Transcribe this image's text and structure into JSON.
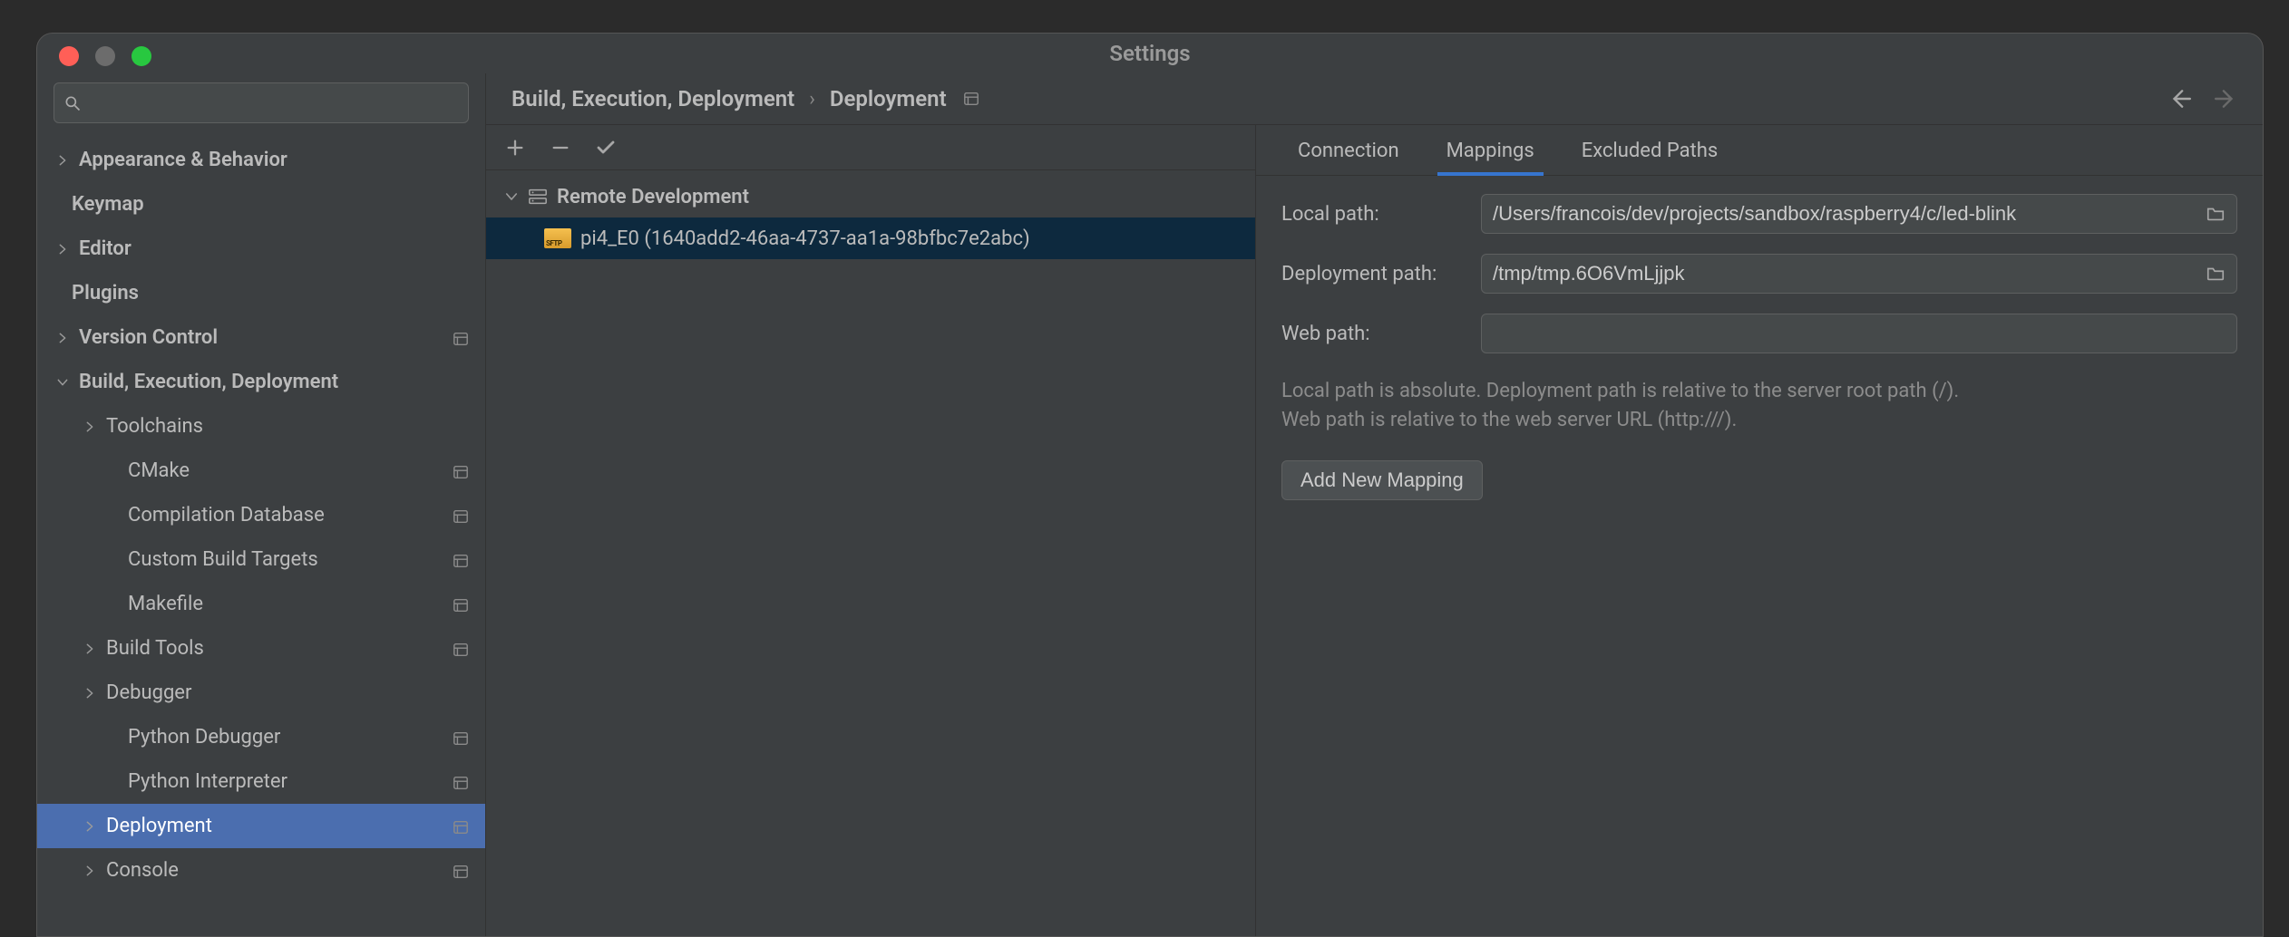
{
  "window": {
    "title": "Settings"
  },
  "search": {
    "value": "",
    "placeholder": ""
  },
  "sidebar": {
    "items": [
      {
        "label": "Appearance & Behavior",
        "chev": "right",
        "bold": true,
        "proj": false,
        "indent": "0c"
      },
      {
        "label": "Keymap",
        "chev": "",
        "bold": true,
        "proj": false,
        "indent": "0"
      },
      {
        "label": "Editor",
        "chev": "right",
        "bold": true,
        "proj": false,
        "indent": "0c"
      },
      {
        "label": "Plugins",
        "chev": "",
        "bold": true,
        "proj": false,
        "indent": "0"
      },
      {
        "label": "Version Control",
        "chev": "right",
        "bold": true,
        "proj": true,
        "indent": "0c"
      },
      {
        "label": "Build, Execution, Deployment",
        "chev": "down",
        "bold": true,
        "proj": false,
        "indent": "0c"
      },
      {
        "label": "Toolchains",
        "chev": "right",
        "bold": false,
        "proj": false,
        "indent": "1c"
      },
      {
        "label": "CMake",
        "chev": "",
        "bold": false,
        "proj": true,
        "indent": "2"
      },
      {
        "label": "Compilation Database",
        "chev": "",
        "bold": false,
        "proj": true,
        "indent": "2"
      },
      {
        "label": "Custom Build Targets",
        "chev": "",
        "bold": false,
        "proj": true,
        "indent": "2"
      },
      {
        "label": "Makefile",
        "chev": "",
        "bold": false,
        "proj": true,
        "indent": "2"
      },
      {
        "label": "Build Tools",
        "chev": "right",
        "bold": false,
        "proj": true,
        "indent": "1c"
      },
      {
        "label": "Debugger",
        "chev": "right",
        "bold": false,
        "proj": false,
        "indent": "1c"
      },
      {
        "label": "Python Debugger",
        "chev": "",
        "bold": false,
        "proj": true,
        "indent": "2"
      },
      {
        "label": "Python Interpreter",
        "chev": "",
        "bold": false,
        "proj": true,
        "indent": "2"
      },
      {
        "label": "Deployment",
        "chev": "right",
        "bold": false,
        "proj": true,
        "indent": "1c",
        "selected": true
      },
      {
        "label": "Console",
        "chev": "right",
        "bold": false,
        "proj": true,
        "indent": "1c"
      }
    ]
  },
  "breadcrumb": {
    "a": "Build, Execution, Deployment",
    "b": "Deployment"
  },
  "servers": {
    "group": "Remote Development",
    "items": [
      {
        "label": "pi4_E0 (1640add2-46aa-4737-aa1a-98bfbc7e2abc)",
        "selected": true
      }
    ]
  },
  "tabs": [
    {
      "label": "Connection"
    },
    {
      "label": "Mappings",
      "active": true
    },
    {
      "label": "Excluded Paths"
    }
  ],
  "form": {
    "local_label": "Local path:",
    "local_value": "/Users/francois/dev/projects/sandbox/raspberry4/c/led-blink",
    "deploy_label": "Deployment path:",
    "deploy_value": "/tmp/tmp.6O6VmLjjpk",
    "web_label": "Web path:",
    "web_value": "",
    "hint1": "Local path is absolute. Deployment path is relative to the server root path (/).",
    "hint2": "Web path is relative to the web server URL (http:///).",
    "add_btn": "Add New Mapping"
  },
  "icons": {
    "search": "search-icon"
  }
}
